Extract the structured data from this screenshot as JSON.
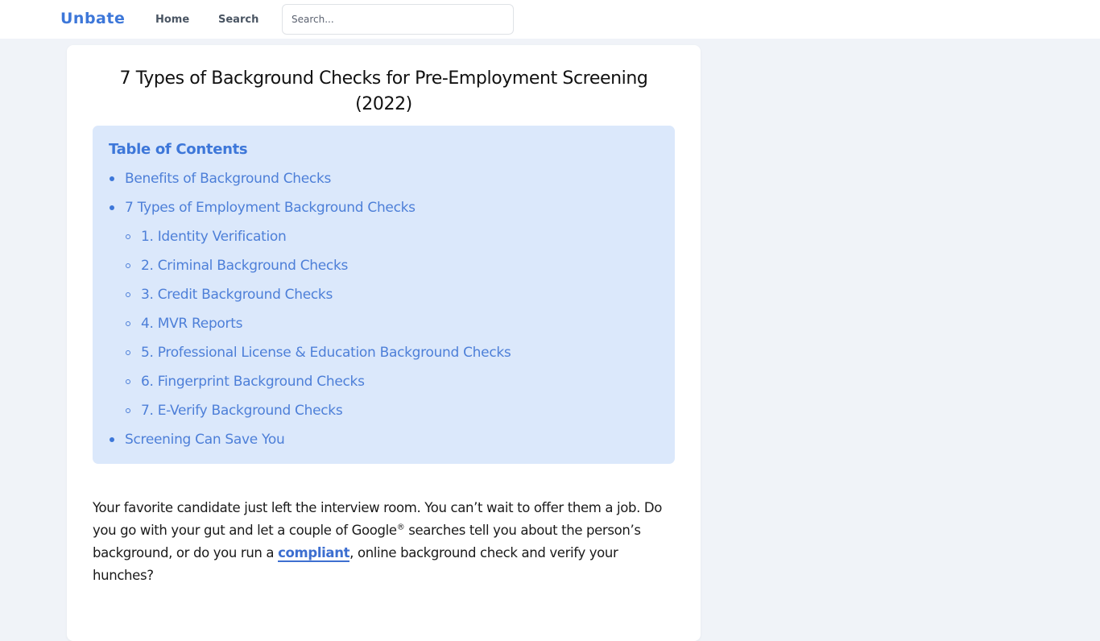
{
  "header": {
    "brand": "Unbate",
    "nav": [
      {
        "label": "Home"
      },
      {
        "label": "Search"
      }
    ],
    "search": {
      "placeholder": "Search...",
      "value": ""
    }
  },
  "article": {
    "title": "7 Types of Background Checks for Pre-Employment Screening (2022)",
    "toc": {
      "heading": "Table of Contents",
      "items": [
        {
          "label": "Benefits of Background Checks",
          "level": 1
        },
        {
          "label": "7 Types of Employment Background Checks",
          "level": 1
        },
        {
          "label": "1. Identity Verification",
          "level": 2
        },
        {
          "label": "2. Criminal Background Checks",
          "level": 2
        },
        {
          "label": "3. Credit Background Checks",
          "level": 2
        },
        {
          "label": "4. MVR Reports",
          "level": 2
        },
        {
          "label": "5. Professional License & Education Background Checks",
          "level": 2
        },
        {
          "label": "6. Fingerprint Background Checks",
          "level": 2
        },
        {
          "label": "7. E-Verify Background Checks",
          "level": 2
        },
        {
          "label": "Screening Can Save You",
          "level": 1
        }
      ]
    },
    "intro": {
      "part1": "Your favorite candidate just left the interview room. You can’t wait to offer them a job. Do you go with your gut and let a couple of Google",
      "sup": "®",
      "part2": " searches tell you about the person’s background, or do you run a ",
      "link": "compliant",
      "part3": ", online background check and verify your hunches?"
    }
  },
  "colors": {
    "brand": "#3d77d9",
    "toc_background": "#dbe8fb",
    "link": "#4d7fd8",
    "page_background": "#f0f3f8"
  }
}
